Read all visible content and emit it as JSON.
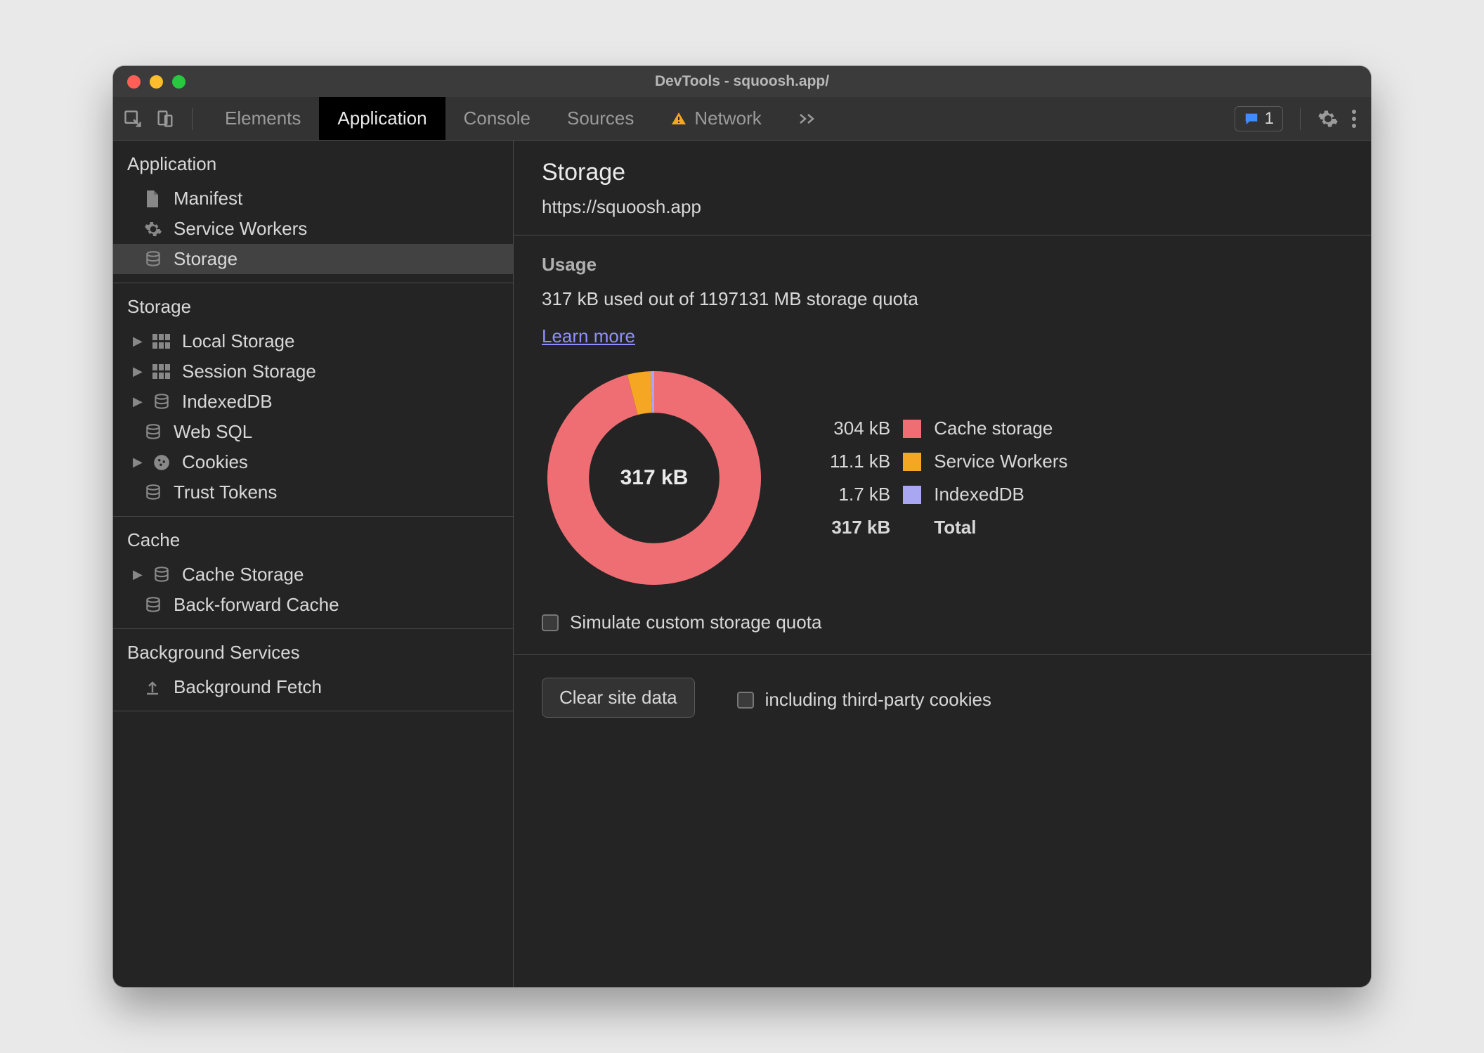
{
  "window": {
    "title": "DevTools - squoosh.app/"
  },
  "toolbar": {
    "tabs": [
      {
        "label": "Elements",
        "active": false
      },
      {
        "label": "Application",
        "active": true
      },
      {
        "label": "Console",
        "active": false
      },
      {
        "label": "Sources",
        "active": false
      },
      {
        "label": "Network",
        "active": false,
        "warning": true
      }
    ],
    "message_count": "1"
  },
  "sidebar": {
    "sections": [
      {
        "heading": "Application",
        "items": [
          {
            "label": "Manifest",
            "icon": "file"
          },
          {
            "label": "Service Workers",
            "icon": "gear"
          },
          {
            "label": "Storage",
            "icon": "db",
            "selected": true
          }
        ]
      },
      {
        "heading": "Storage",
        "items": [
          {
            "label": "Local Storage",
            "icon": "grid",
            "expandable": true
          },
          {
            "label": "Session Storage",
            "icon": "grid",
            "expandable": true
          },
          {
            "label": "IndexedDB",
            "icon": "db",
            "expandable": true
          },
          {
            "label": "Web SQL",
            "icon": "db"
          },
          {
            "label": "Cookies",
            "icon": "cookie",
            "expandable": true
          },
          {
            "label": "Trust Tokens",
            "icon": "db"
          }
        ]
      },
      {
        "heading": "Cache",
        "items": [
          {
            "label": "Cache Storage",
            "icon": "db",
            "expandable": true
          },
          {
            "label": "Back-forward Cache",
            "icon": "db"
          }
        ]
      },
      {
        "heading": "Background Services",
        "items": [
          {
            "label": "Background Fetch",
            "icon": "upload"
          }
        ]
      }
    ]
  },
  "main": {
    "title": "Storage",
    "origin": "https://squoosh.app",
    "usage_label": "Usage",
    "usage_text": "317 kB used out of 1197131 MB storage quota",
    "learn_more": "Learn more",
    "donut_center": "317 kB",
    "simulate_label": "Simulate custom storage quota",
    "clear_button": "Clear site data",
    "third_party_label": "including third-party cookies",
    "legend": [
      {
        "value": "304 kB",
        "color": "#ee6e73",
        "label": "Cache storage"
      },
      {
        "value": "11.1 kB",
        "color": "#f5a623",
        "label": "Service Workers"
      },
      {
        "value": "1.7 kB",
        "color": "#a9a6f2",
        "label": "IndexedDB"
      },
      {
        "value": "317 kB",
        "color": "",
        "label": "Total",
        "total": true
      }
    ]
  },
  "chart_data": {
    "type": "pie",
    "title": "Storage usage breakdown",
    "series": [
      {
        "name": "Cache storage",
        "value": 304,
        "unit": "kB",
        "color": "#ee6e73"
      },
      {
        "name": "Service Workers",
        "value": 11.1,
        "unit": "kB",
        "color": "#f5a623"
      },
      {
        "name": "IndexedDB",
        "value": 1.7,
        "unit": "kB",
        "color": "#a9a6f2"
      }
    ],
    "total": {
      "value": 317,
      "unit": "kB"
    }
  }
}
